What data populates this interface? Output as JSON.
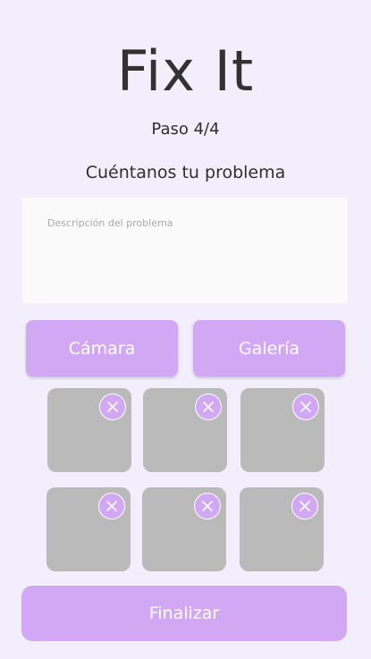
{
  "header": {
    "title": "Fix It",
    "step": "Paso 4/4",
    "heading": "Cuéntanos tu problema"
  },
  "description": {
    "placeholder": "Descripción del problema",
    "value": ""
  },
  "actions": {
    "camera_label": "Cámara",
    "gallery_label": "Galería"
  },
  "photos": {
    "slot_count": 6,
    "remove_icon": "close-icon"
  },
  "footer": {
    "finish_label": "Finalizar"
  },
  "colors": {
    "background": "#f2eefb",
    "accent": "#d2a8f4",
    "photo_placeholder": "#bababa",
    "field_background": "#fafafa"
  }
}
